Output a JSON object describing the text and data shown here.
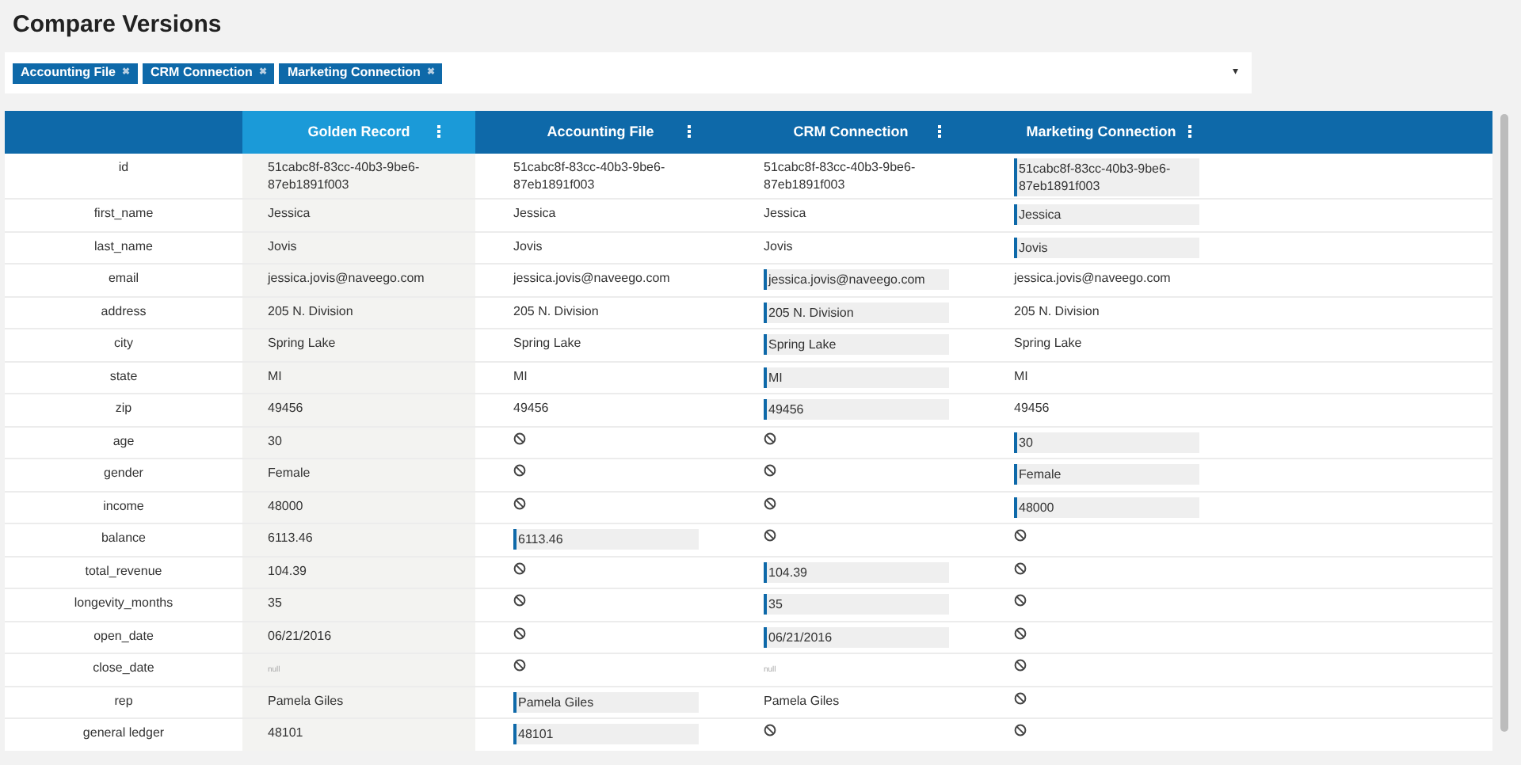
{
  "title": "Compare Versions",
  "filter": {
    "tags": [
      {
        "label": "Accounting File",
        "remove": "✖"
      },
      {
        "label": "CRM Connection",
        "remove": "✖"
      },
      {
        "label": "Marketing Connection",
        "remove": "✖"
      }
    ],
    "caret": "▾"
  },
  "table": {
    "columns": [
      {
        "label": "Golden Record",
        "kind": "golden"
      },
      {
        "label": "Accounting File",
        "kind": "source"
      },
      {
        "label": "CRM Connection",
        "kind": "source"
      },
      {
        "label": "Marketing Connection",
        "kind": "source"
      }
    ],
    "rows": [
      {
        "field": "id",
        "golden": {
          "kind": "text",
          "text": "51cabc8f-83cc-40b3-9be6-87eb1891f003"
        },
        "sources": [
          {
            "kind": "text",
            "text": "51cabc8f-83cc-40b3-9be6-87eb1891f003",
            "selected": false
          },
          {
            "kind": "text",
            "text": "51cabc8f-83cc-40b3-9be6-87eb1891f003",
            "selected": false
          },
          {
            "kind": "text",
            "text": "51cabc8f-83cc-40b3-9be6-87eb1891f003",
            "selected": true
          }
        ]
      },
      {
        "field": "first_name",
        "golden": {
          "kind": "text",
          "text": "Jessica"
        },
        "sources": [
          {
            "kind": "text",
            "text": "Jessica",
            "selected": false
          },
          {
            "kind": "text",
            "text": "Jessica",
            "selected": false
          },
          {
            "kind": "text",
            "text": "Jessica",
            "selected": true
          }
        ]
      },
      {
        "field": "last_name",
        "golden": {
          "kind": "text",
          "text": "Jovis"
        },
        "sources": [
          {
            "kind": "text",
            "text": "Jovis",
            "selected": false
          },
          {
            "kind": "text",
            "text": "Jovis",
            "selected": false
          },
          {
            "kind": "text",
            "text": "Jovis",
            "selected": true
          }
        ]
      },
      {
        "field": "email",
        "golden": {
          "kind": "text",
          "text": "jessica.jovis@naveego.com"
        },
        "sources": [
          {
            "kind": "text",
            "text": "jessica.jovis@naveego.com",
            "selected": false
          },
          {
            "kind": "text",
            "text": "jessica.jovis@naveego.com",
            "selected": true
          },
          {
            "kind": "text",
            "text": "jessica.jovis@naveego.com",
            "selected": false
          }
        ]
      },
      {
        "field": "address",
        "golden": {
          "kind": "text",
          "text": "205 N. Division"
        },
        "sources": [
          {
            "kind": "text",
            "text": "205 N. Division",
            "selected": false
          },
          {
            "kind": "text",
            "text": "205 N. Division",
            "selected": true
          },
          {
            "kind": "text",
            "text": "205 N. Division",
            "selected": false
          }
        ]
      },
      {
        "field": "city",
        "golden": {
          "kind": "text",
          "text": "Spring Lake"
        },
        "sources": [
          {
            "kind": "text",
            "text": "Spring Lake",
            "selected": false
          },
          {
            "kind": "text",
            "text": "Spring Lake",
            "selected": true
          },
          {
            "kind": "text",
            "text": "Spring Lake",
            "selected": false
          }
        ]
      },
      {
        "field": "state",
        "golden": {
          "kind": "text",
          "text": "MI"
        },
        "sources": [
          {
            "kind": "text",
            "text": "MI",
            "selected": false
          },
          {
            "kind": "text",
            "text": "MI",
            "selected": true
          },
          {
            "kind": "text",
            "text": "MI",
            "selected": false
          }
        ]
      },
      {
        "field": "zip",
        "golden": {
          "kind": "text",
          "text": "49456"
        },
        "sources": [
          {
            "kind": "text",
            "text": "49456",
            "selected": false
          },
          {
            "kind": "text",
            "text": "49456",
            "selected": true
          },
          {
            "kind": "text",
            "text": "49456",
            "selected": false
          }
        ]
      },
      {
        "field": "age",
        "golden": {
          "kind": "text",
          "text": "30"
        },
        "sources": [
          {
            "kind": "empty"
          },
          {
            "kind": "empty"
          },
          {
            "kind": "text",
            "text": "30",
            "selected": true
          }
        ]
      },
      {
        "field": "gender",
        "golden": {
          "kind": "text",
          "text": "Female"
        },
        "sources": [
          {
            "kind": "empty"
          },
          {
            "kind": "empty"
          },
          {
            "kind": "text",
            "text": "Female",
            "selected": true
          }
        ]
      },
      {
        "field": "income",
        "golden": {
          "kind": "text",
          "text": "48000"
        },
        "sources": [
          {
            "kind": "empty"
          },
          {
            "kind": "empty"
          },
          {
            "kind": "text",
            "text": "48000",
            "selected": true
          }
        ]
      },
      {
        "field": "balance",
        "golden": {
          "kind": "text",
          "text": "6113.46"
        },
        "sources": [
          {
            "kind": "text",
            "text": "6113.46",
            "selected": true
          },
          {
            "kind": "empty"
          },
          {
            "kind": "empty"
          }
        ]
      },
      {
        "field": "total_revenue",
        "golden": {
          "kind": "text",
          "text": "104.39"
        },
        "sources": [
          {
            "kind": "empty"
          },
          {
            "kind": "text",
            "text": "104.39",
            "selected": true
          },
          {
            "kind": "empty"
          }
        ]
      },
      {
        "field": "longevity_months",
        "golden": {
          "kind": "text",
          "text": "35"
        },
        "sources": [
          {
            "kind": "empty"
          },
          {
            "kind": "text",
            "text": "35",
            "selected": true
          },
          {
            "kind": "empty"
          }
        ]
      },
      {
        "field": "open_date",
        "golden": {
          "kind": "text",
          "text": "06/21/2016"
        },
        "sources": [
          {
            "kind": "empty"
          },
          {
            "kind": "text",
            "text": "06/21/2016",
            "selected": true
          },
          {
            "kind": "empty"
          }
        ]
      },
      {
        "field": "close_date",
        "golden": {
          "kind": "null",
          "text": "null"
        },
        "sources": [
          {
            "kind": "empty"
          },
          {
            "kind": "null",
            "text": "null"
          },
          {
            "kind": "empty"
          }
        ]
      },
      {
        "field": "rep",
        "golden": {
          "kind": "text",
          "text": "Pamela Giles"
        },
        "sources": [
          {
            "kind": "text",
            "text": "Pamela Giles",
            "selected": true
          },
          {
            "kind": "text",
            "text": "Pamela Giles",
            "selected": false
          },
          {
            "kind": "empty"
          }
        ]
      },
      {
        "field": "general ledger",
        "golden": {
          "kind": "text",
          "text": "48101"
        },
        "sources": [
          {
            "kind": "text",
            "text": "48101",
            "selected": true
          },
          {
            "kind": "empty"
          },
          {
            "kind": "empty"
          }
        ]
      }
    ]
  }
}
